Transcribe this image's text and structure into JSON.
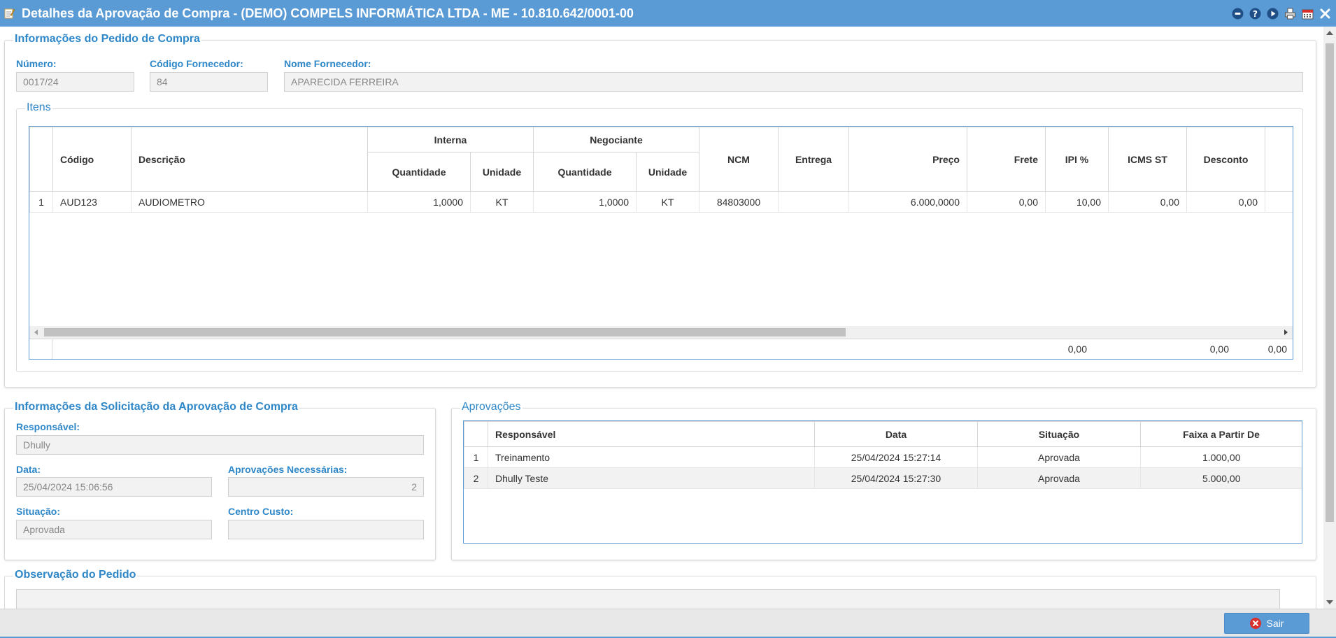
{
  "window": {
    "title": "Detalhes da Aprovação de Compra - (DEMO) COMPELS INFORMÁTICA LTDA - ME - 10.810.642/0001-00",
    "buttons": [
      "minimize-icon",
      "help-icon",
      "play-icon",
      "print-icon",
      "calendar-icon",
      "close-icon"
    ]
  },
  "pedido": {
    "legend": "Informações do Pedido de Compra",
    "numero_label": "Número:",
    "numero_value": "0017/24",
    "codigo_fornecedor_label": "Código Fornecedor:",
    "codigo_fornecedor_value": "84",
    "nome_fornecedor_label": "Nome Fornecedor:",
    "nome_fornecedor_value": "APARECIDA FERREIRA"
  },
  "itens": {
    "legend": "Itens",
    "headers": {
      "codigo": "Código",
      "descricao": "Descrição",
      "interna": "Interna",
      "negociante": "Negociante",
      "quantidade": "Quantidade",
      "unidade": "Unidade",
      "ncm": "NCM",
      "entrega": "Entrega",
      "preco": "Preço",
      "frete": "Frete",
      "ipi": "IPI %",
      "icms_st": "ICMS ST",
      "desconto": "Desconto"
    },
    "rows": [
      {
        "n": "1",
        "codigo": "AUD123",
        "descricao": "AUDIOMETRO",
        "int_qtd": "1,0000",
        "int_un": "KT",
        "neg_qtd": "1,0000",
        "neg_un": "KT",
        "ncm": "84803000",
        "entrega": "",
        "preco": "6.000,0000",
        "frete": "0,00",
        "ipi": "10,00",
        "icms_st": "0,00",
        "desconto": "0,00"
      }
    ],
    "totals": {
      "frete": "0,00",
      "icms_st": "0,00",
      "desconto": "0,00"
    }
  },
  "solicitacao": {
    "legend": "Informações da Solicitação da Aprovação de Compra",
    "responsavel_label": "Responsável:",
    "responsavel_value": "Dhully",
    "data_label": "Data:",
    "data_value": "25/04/2024 15:06:56",
    "aprovacoes_label": "Aprovações Necessárias:",
    "aprovacoes_value": "2",
    "situacao_label": "Situação:",
    "situacao_value": "Aprovada",
    "centro_custo_label": "Centro Custo:",
    "centro_custo_value": ""
  },
  "aprovacoes": {
    "legend": "Aprovações",
    "headers": {
      "responsavel": "Responsável",
      "data": "Data",
      "situacao": "Situação",
      "faixa": "Faixa a Partir De"
    },
    "rows": [
      {
        "n": "1",
        "responsavel": "Treinamento",
        "data": "25/04/2024 15:27:14",
        "situacao": "Aprovada",
        "faixa": "1.000,00"
      },
      {
        "n": "2",
        "responsavel": "Dhully Teste",
        "data": "25/04/2024 15:27:30",
        "situacao": "Aprovada",
        "faixa": "5.000,00"
      }
    ]
  },
  "observacao": {
    "legend": "Observação do Pedido",
    "value": ""
  },
  "footer": {
    "sair_label": "Sair"
  },
  "colors": {
    "accent": "#5b9bd5",
    "label": "#2e87c8",
    "exit": "#d9302c"
  }
}
